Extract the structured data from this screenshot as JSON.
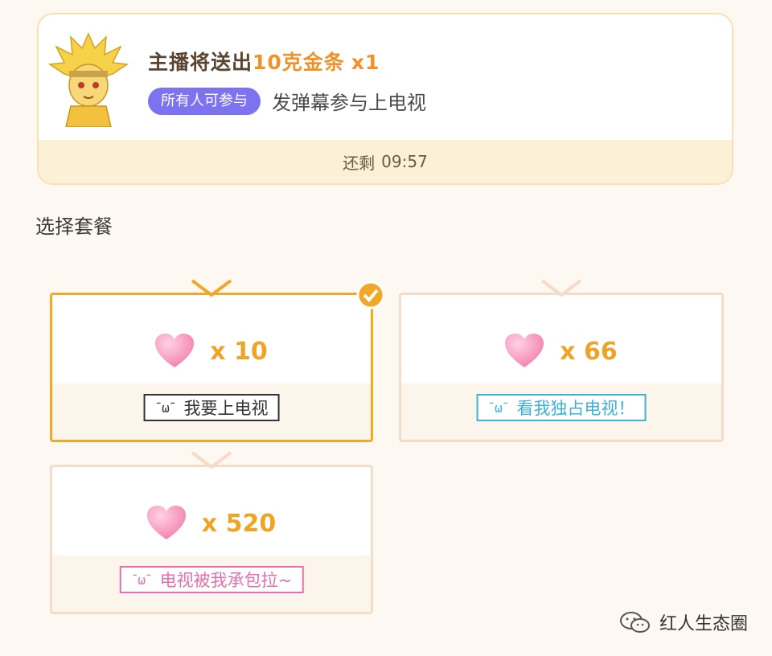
{
  "header": {
    "prize_prefix": "主播将送出",
    "prize_name": "10克金条",
    "prize_qty": "x1",
    "badge": "所有人可参与",
    "instruction": "发弹幕参与上电视",
    "timer_label": "还剩",
    "timer_value": "09:57"
  },
  "section_title": "选择套餐",
  "packages": [
    {
      "count": "x 10",
      "face": "¯ω¯",
      "tagline": "我要上电视",
      "tag_color": "#333333",
      "selected": true
    },
    {
      "count": "x 66",
      "face": "¯ω¯",
      "tagline": "看我独占电视！",
      "tag_color": "#3fb1d8",
      "selected": false
    },
    {
      "count": "x 520",
      "face": "¯ω¯",
      "tagline": "电视被我承包拉~",
      "tag_color": "#e46fae",
      "selected": false
    }
  ],
  "watermark": "红人生态圈",
  "colors": {
    "accent": "#f2a726",
    "badge": "#7d72f0",
    "prize": "#f0912a"
  }
}
